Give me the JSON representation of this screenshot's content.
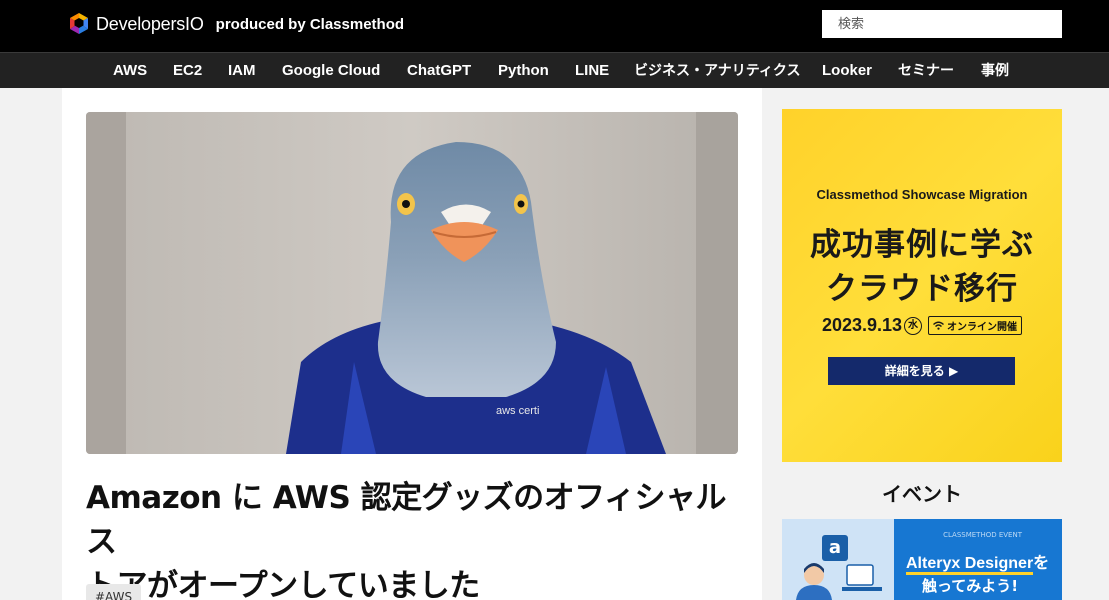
{
  "header": {
    "logo_text": "DevelopersIO",
    "logo_subtitle": "produced by Classmethod",
    "search_placeholder": "検索"
  },
  "nav": {
    "items": [
      "AWS",
      "EC2",
      "IAM",
      "Google Cloud",
      "ChatGPT",
      "Python",
      "LINE",
      "ビジネス・アナリティクス",
      "Looker",
      "セミナー",
      "事例"
    ]
  },
  "article": {
    "hero_alt_text": "aws certi",
    "title_line1": "Amazon に AWS 認定グッズのオフィシャルス",
    "title_line2": "トアがオープンしていました",
    "tag": "#AWS"
  },
  "sidebar": {
    "banner": {
      "subtitle": "Classmethod Showcase Migration",
      "headline1": "成功事例に学ぶ",
      "headline2": "クラウド移行",
      "date": "2023.9.13",
      "day": "水",
      "online_label": "オンライン開催",
      "button_label": "詳細を見る ▶"
    },
    "events_heading": "イベント",
    "event_card": {
      "small_text": "CLASSMETHOD EVENT",
      "title_a": "Alteryx Designer",
      "title_suffix": "を",
      "title_b": "触ってみよう!",
      "icon_letter": "a"
    }
  },
  "colors": {
    "header_bg": "#000000",
    "nav_bg": "#222222",
    "banner_yellow": "#ffd22a",
    "banner_button": "#14296b",
    "event_blue": "#1777d2"
  }
}
